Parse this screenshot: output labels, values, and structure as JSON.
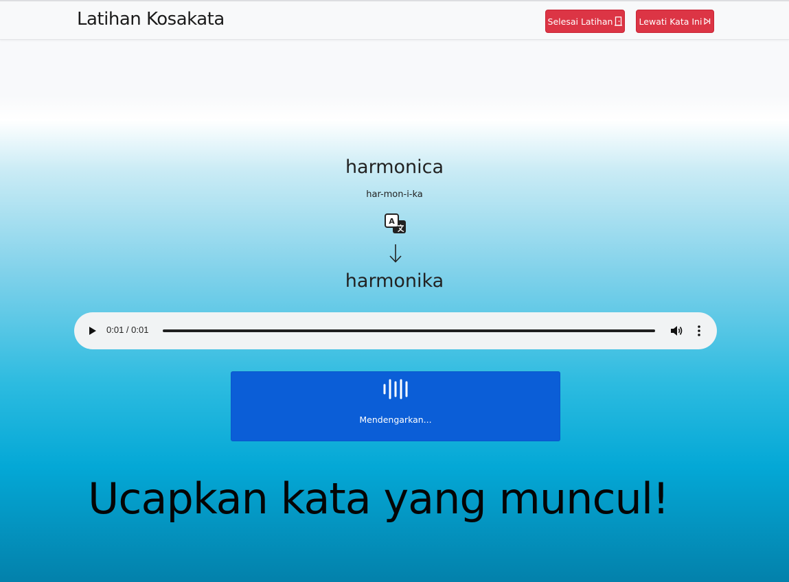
{
  "header": {
    "title": "Latihan Kosakata",
    "finish_label": "Selesai Latihan",
    "skip_label": "Lewati Kata Ini"
  },
  "word": {
    "english": "harmonica",
    "syllables": "har-mon-i-ka",
    "indonesian": "harmonika"
  },
  "icons": {
    "translate": "translate-icon",
    "arrow": "arrow-down-icon",
    "finish": "door-exit-icon",
    "skip": "skip-forward-icon",
    "listen": "soundwave-icon"
  },
  "audio": {
    "time": "0:01 / 0:01",
    "progress": 1.0
  },
  "listen": {
    "label": "Mendengarkan..."
  },
  "prompt": {
    "text": "Ucapkan kata yang muncul!"
  },
  "colors": {
    "danger": "#dc3545",
    "primary": "#0b5ed7"
  }
}
